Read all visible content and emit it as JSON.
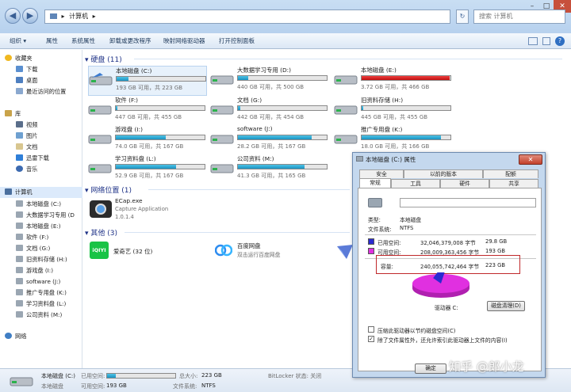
{
  "window": {
    "breadcrumb_sep": "▸",
    "address": "计算机",
    "address_chevron": "▸",
    "search_placeholder": "搜索 计算机",
    "min": "–",
    "max": "□",
    "close": "✕",
    "back": "◀",
    "forward": "▶",
    "refresh": "↻"
  },
  "toolbar": {
    "items": [
      "组织 ▾",
      "属性",
      "系统属性",
      "卸载或更改程序",
      "映射网络驱动器",
      "打开控制面板"
    ]
  },
  "nav": {
    "favorites": {
      "label": "收藏夹",
      "items": [
        "下载",
        "桌面",
        "最近访问的位置"
      ]
    },
    "libraries": {
      "label": "库",
      "items": [
        "视频",
        "图片",
        "文档",
        "迅雷下载",
        "音乐"
      ]
    },
    "computer": {
      "label": "计算机",
      "items": [
        "本地磁盘 (C:)",
        "大数据学习专用 (D",
        "本地磁盘 (E:)",
        "软件 (F:)",
        "文档 (G:)",
        "旧资料存储 (H:)",
        "游戏盘 (I:)",
        "software (J:)",
        "推广专用盘 (K:)",
        "学习资料盘 (L:)",
        "公司资料 (M:)"
      ]
    },
    "network": {
      "label": "网络"
    }
  },
  "sections": {
    "drives": "硬盘 (11)",
    "network": "网络位置 (1)",
    "other": "其他 (3)"
  },
  "drives": [
    {
      "name": "本地磁盘 (C:)",
      "free": "193 GB 可用，共 223 GB",
      "used": 0.13
    },
    {
      "name": "大数据学习专用 (D:)",
      "free": "440 GB 可用，共 500 GB",
      "used": 0.12
    },
    {
      "name": "本地磁盘 (E:)",
      "free": "3.72 GB 可用，共 466 GB",
      "used": 0.99
    },
    {
      "name": "软件 (F:)",
      "free": "447 GB 可用，共 455 GB",
      "used": 0.02
    },
    {
      "name": "文档 (G:)",
      "free": "442 GB 可用，共 454 GB",
      "used": 0.03
    },
    {
      "name": "旧资料存储 (H:)",
      "free": "445 GB 可用，共 455 GB",
      "used": 0.02
    },
    {
      "name": "游戏盘 (I:)",
      "free": "74.0 GB 可用，共 167 GB",
      "used": 0.56
    },
    {
      "name": "software (J:)",
      "free": "28.2 GB 可用，共 167 GB",
      "used": 0.83
    },
    {
      "name": "推广专用盘 (K:)",
      "free": "18.0 GB 可用，共 166 GB",
      "used": 0.89
    },
    {
      "name": "学习资料盘 (L:)",
      "free": "52.9 GB 可用，共 167 GB",
      "used": 0.68
    },
    {
      "name": "公司资料 (M:)",
      "free": "41.3 GB 可用，共 165 GB",
      "used": 0.75
    }
  ],
  "network_items": [
    {
      "name": "ECap.exe",
      "sub1": "Capture Application",
      "sub2": "1.0.1.4"
    }
  ],
  "other_items": [
    {
      "name": "爱奇艺 (32 位)",
      "logo": "iQIYI"
    },
    {
      "name": "百度网盘",
      "sub": "双击运行百度网盘"
    }
  ],
  "status": {
    "name": "本地磁盘 (C:)",
    "kind": "本地磁盘",
    "used_label": "已用空间:",
    "free_label": "可用空间:",
    "free_value": "193 GB",
    "total_label": "总大小:",
    "total_value": "223 GB",
    "fs_label": "文件系统:",
    "fs_value": "NTFS",
    "bitlocker": "BitLocker 状态: 关闭",
    "used_fraction": 0.13
  },
  "dialog": {
    "title": "本地磁盘 (C:) 属性",
    "tabs_row1": [
      "安全",
      "以前的版本",
      "配额"
    ],
    "tabs_row2": [
      "常规",
      "工具",
      "硬件",
      "共享"
    ],
    "type_label": "类型:",
    "type_value": "本地磁盘",
    "fs_label": "文件系统:",
    "fs_value": "NTFS",
    "used_label": "已用空间:",
    "used_bytes": "32,046,379,008 字节",
    "used_gb": "29.8 GB",
    "free_label": "可用空间:",
    "free_bytes": "208,009,363,456 字节",
    "free_gb": "193 GB",
    "cap_label": "容量:",
    "cap_bytes": "240,055,742,464 字节",
    "cap_gb": "223 GB",
    "drive_label": "驱动器 C:",
    "cleanup": "磁盘清理(D)",
    "compress": "压缩此驱动器以节约磁盘空间(C)",
    "index": "除了文件属性外，还允许索引此驱动器上文件的内容(I)",
    "ok": "确定",
    "used_color": "#2a2ad0",
    "free_color": "#e030e0",
    "used_fraction": 0.133
  },
  "watermark": "知乎 @郎小龙"
}
